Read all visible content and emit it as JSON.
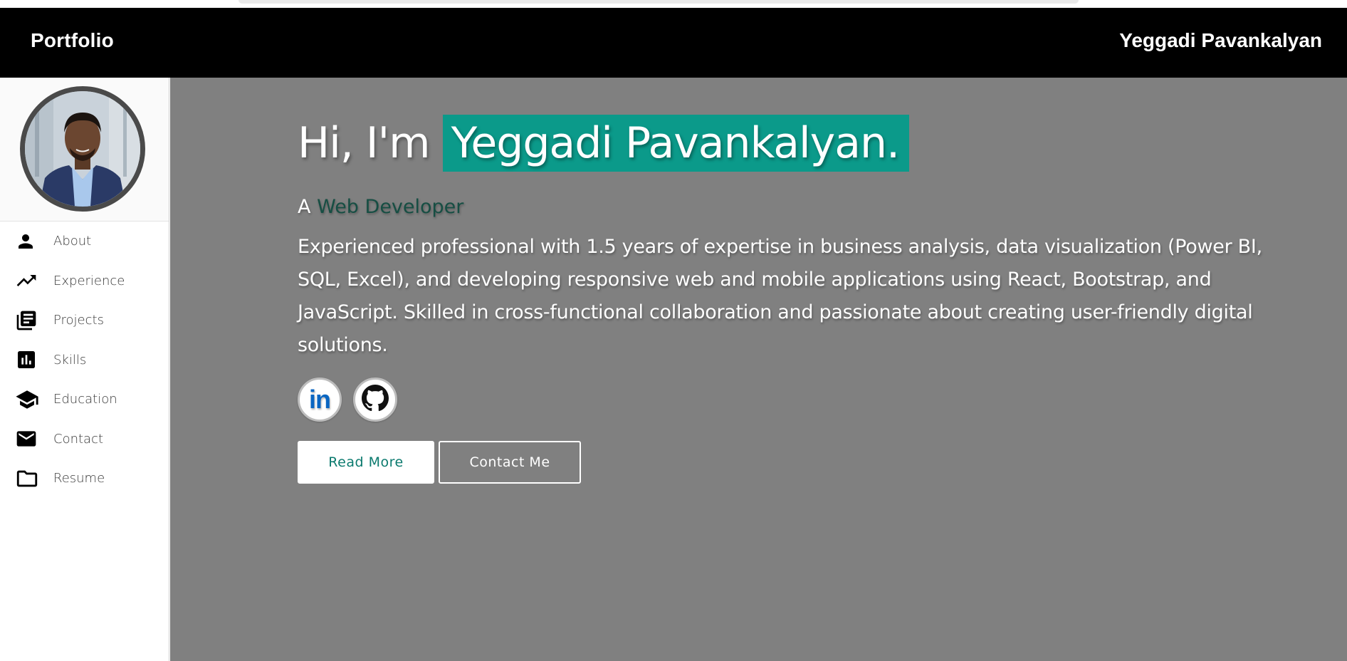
{
  "navbar": {
    "brand": "Portfolio",
    "owner": "Yeggadi Pavankalyan"
  },
  "sidebar": {
    "items": [
      {
        "label": "About",
        "icon": "person-icon"
      },
      {
        "label": "Experience",
        "icon": "trending-up-icon"
      },
      {
        "label": "Projects",
        "icon": "library-books-icon"
      },
      {
        "label": "Skills",
        "icon": "bar-chart-icon"
      },
      {
        "label": "Education",
        "icon": "graduation-cap-icon"
      },
      {
        "label": "Contact",
        "icon": "mail-icon"
      },
      {
        "label": "Resume",
        "icon": "folder-icon"
      }
    ]
  },
  "hero": {
    "greeting": "Hi, I'm",
    "name": "Yeggadi Pavankalyan.",
    "role_prefix": "A",
    "role": "Web Developer",
    "bio": "Experienced professional with 1.5 years of expertise in business analysis, data visualization (Power BI, SQL, Excel), and developing responsive web and mobile applications using React, Bootstrap, and JavaScript. Skilled in cross-functional collaboration and passionate about creating user-friendly digital solutions.",
    "socials": [
      {
        "icon": "linkedin-icon",
        "text": "in"
      },
      {
        "icon": "github-icon"
      }
    ],
    "read_more_label": "Read More",
    "contact_label": "Contact Me"
  },
  "colors": {
    "navbar_bg": "#000000",
    "main_bg": "#808080",
    "highlight": "#0b9a8a",
    "role_accent": "#164e43",
    "linkedin_blue": "#0a66c2"
  }
}
